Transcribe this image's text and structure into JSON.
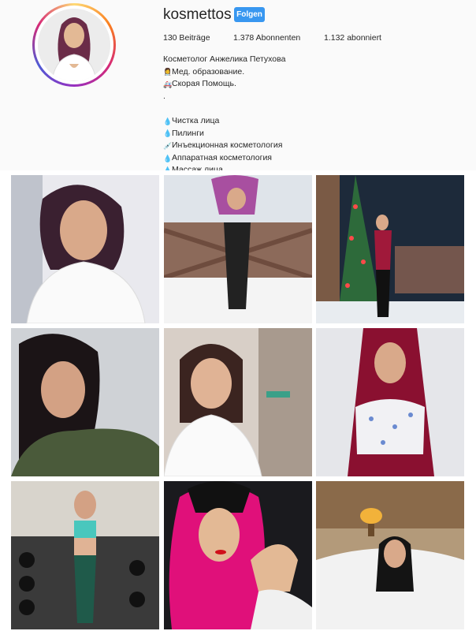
{
  "profile": {
    "username": "kosmettos",
    "follow_label": "Folgen",
    "posts": "130 Beiträge",
    "followers": "1.378 Abonnenten",
    "following": "1.132 abonniert",
    "bio": {
      "name": "Косметолог Анжелика Петухова",
      "lines": [
        {
          "icon": "doctor-icon",
          "glyph": "👩‍⚕",
          "text": "Мед. образование."
        },
        {
          "icon": "ambulance-icon",
          "glyph": "🚑",
          "text": "Скорая Помощь."
        },
        {
          "icon": "",
          "glyph": "",
          "text": "."
        },
        {
          "icon": "",
          "glyph": "",
          "text": ""
        },
        {
          "icon": "droplet-icon",
          "glyph": "💧",
          "text": "Чистка лица"
        },
        {
          "icon": "droplet-icon",
          "glyph": "💧",
          "text": "Пилинги"
        },
        {
          "icon": "syringe-icon",
          "glyph": "💉",
          "text": "Инъекционная косметология"
        },
        {
          "icon": "droplet-icon",
          "glyph": "💧",
          "text": "Аппаратная косметология"
        },
        {
          "icon": "droplet-icon",
          "glyph": "💧",
          "text": "Массаж лица"
        }
      ]
    }
  },
  "colors": {
    "follow_button": "#3897f0",
    "background": "#fafafa",
    "text": "#262626"
  },
  "posts_grid": [
    {
      "id": "post-1",
      "desc": "portrait white coat"
    },
    {
      "id": "post-2",
      "desc": "snow balcony"
    },
    {
      "id": "post-3",
      "desc": "christmas tree night"
    },
    {
      "id": "post-4",
      "desc": "green top selfie"
    },
    {
      "id": "post-5",
      "desc": "white polo clinic"
    },
    {
      "id": "post-6",
      "desc": "red hair floral top"
    },
    {
      "id": "post-7",
      "desc": "gym teal top"
    },
    {
      "id": "post-8",
      "desc": "pink hair car"
    },
    {
      "id": "post-9",
      "desc": "bed lamp"
    }
  ]
}
